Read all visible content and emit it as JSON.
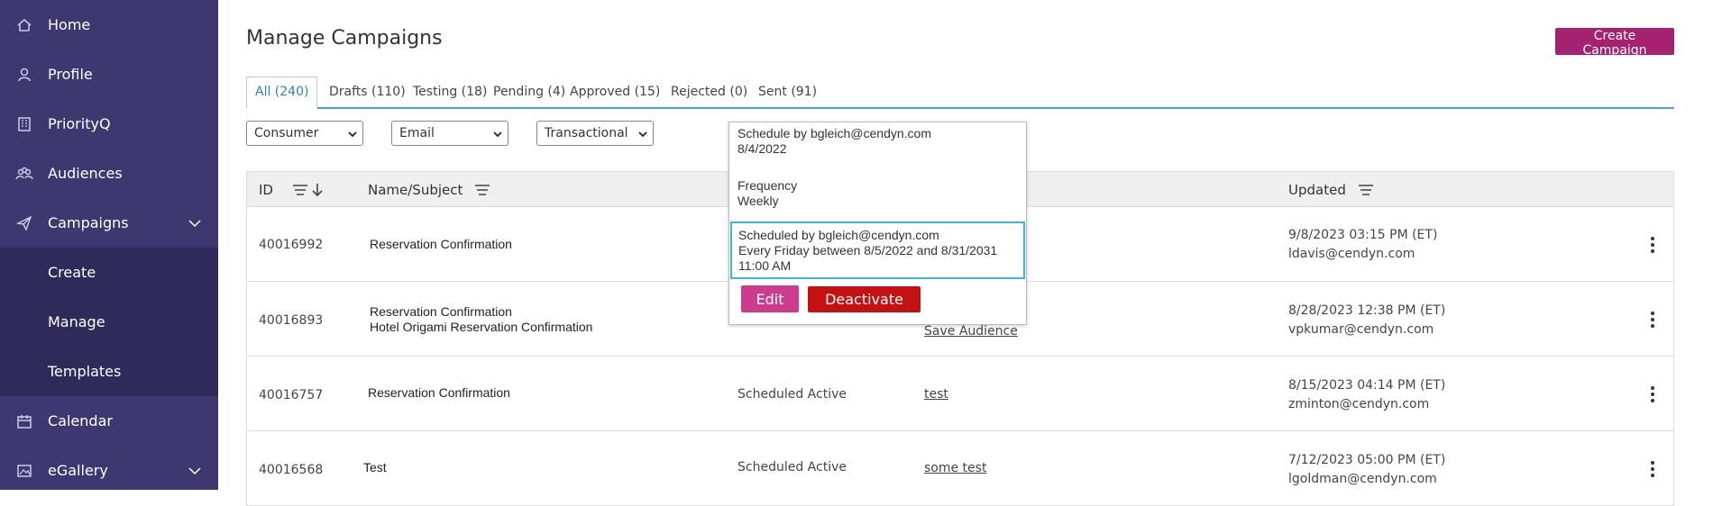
{
  "sidebar": {
    "items": [
      {
        "label": "Home",
        "icon": "home-icon"
      },
      {
        "label": "Profile",
        "icon": "user-icon"
      },
      {
        "label": "PriorityQ",
        "icon": "building-icon"
      },
      {
        "label": "Audiences",
        "icon": "people-icon"
      },
      {
        "label": "Campaigns",
        "icon": "send-icon"
      },
      {
        "label": "Calendar",
        "icon": "calendar-icon"
      },
      {
        "label": "eGallery",
        "icon": "image-icon"
      }
    ],
    "campaigns_sub": [
      {
        "label": "Create"
      },
      {
        "label": "Manage"
      },
      {
        "label": "Templates"
      }
    ]
  },
  "page": {
    "title": "Manage Campaigns",
    "create_label": "Create Campaign"
  },
  "tabs": [
    {
      "label": "All (240)"
    },
    {
      "label": "Drafts (110)"
    },
    {
      "label": "Testing (18)"
    },
    {
      "label": "Pending (4)"
    },
    {
      "label": "Approved (15)"
    },
    {
      "label": "Rejected (0)"
    },
    {
      "label": "Sent (91)"
    }
  ],
  "filters": {
    "audience_type": "Consumer",
    "channel": "Email",
    "category": "Transactional"
  },
  "table": {
    "headers": {
      "id": "ID",
      "name": "Name/Subject",
      "updated": "Updated"
    },
    "rows": [
      {
        "id": "40016992",
        "name": "Reservation Confirmation",
        "subject": "",
        "status": "",
        "audience": "",
        "updated": "9/8/2023 03:15 PM (ET)",
        "user": "ldavis@cendyn.com"
      },
      {
        "id": "40016893",
        "name": "Reservation Confirmation",
        "subject": "Hotel Origami Reservation Confirmation",
        "status": "",
        "audience": "Save Audience",
        "updated": "8/28/2023 12:38 PM (ET)",
        "user": "vpkumar@cendyn.com"
      },
      {
        "id": "40016757",
        "name": "Reservation Confirmation",
        "subject": "",
        "status": "Scheduled Active",
        "audience": "test",
        "updated": "8/15/2023 04:14 PM (ET)",
        "user": "zminton@cendyn.com"
      },
      {
        "id": "40016568",
        "name": "Test",
        "subject": "",
        "status": "Scheduled Active",
        "audience": "some test",
        "updated": "7/12/2023 05:00 PM (ET)",
        "user": "lgoldman@cendyn.com"
      }
    ]
  },
  "popup": {
    "schedule_by": "Schedule by bgleich@cendyn.com",
    "schedule_date": "8/4/2022",
    "frequency_label": "Frequency",
    "frequency_value": "Weekly",
    "scheduled_by": "Scheduled by bgleich@cendyn.com",
    "scheduled_rule": "Every Friday between 8/5/2022 and 8/31/2031",
    "scheduled_time": "11:00 AM",
    "edit_label": "Edit",
    "deactivate_label": "Deactivate"
  },
  "colors": {
    "sidebar": "#3d3870",
    "sidebar_sub": "#2e2a5a",
    "accent": "#a52270",
    "tab_line": "#47a6c2",
    "deactivate": "#c41212"
  }
}
